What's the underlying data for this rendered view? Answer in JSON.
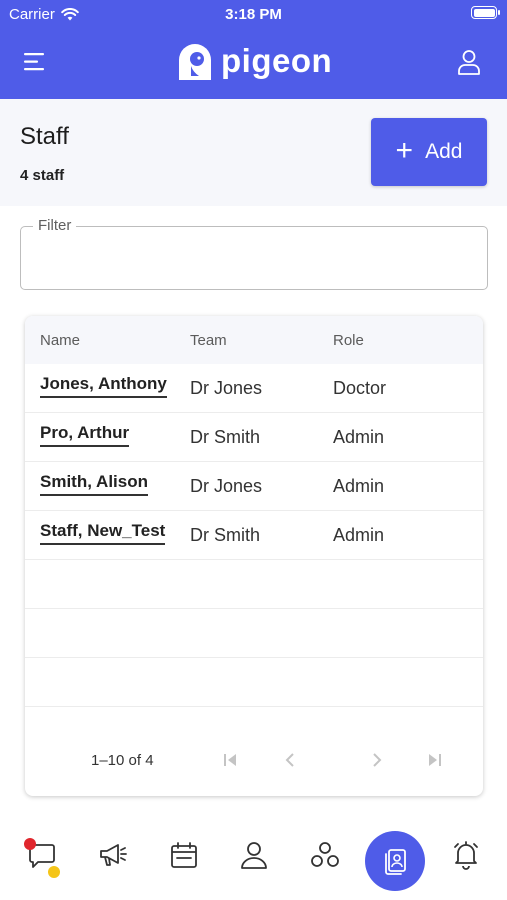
{
  "status_bar": {
    "carrier": "Carrier",
    "time": "3:18 PM"
  },
  "header": {
    "logo_text": "pigeon"
  },
  "page": {
    "title": "Staff",
    "count": "4 staff",
    "add_label": "Add"
  },
  "filter": {
    "label": "Filter",
    "value": "",
    "placeholder": ""
  },
  "table": {
    "columns": [
      "Name",
      "Team",
      "Role"
    ],
    "rows": [
      {
        "name": "Jones, Anthony",
        "team": "Dr Jones",
        "role": "Doctor"
      },
      {
        "name": "Pro, Arthur",
        "team": "Dr Smith",
        "role": "Admin"
      },
      {
        "name": "Smith, Alison",
        "team": "Dr Jones",
        "role": "Admin"
      },
      {
        "name": "Staff, New_Test",
        "team": "Dr Smith",
        "role": "Admin"
      }
    ],
    "pagination": "1–10 of 4"
  },
  "icons": {
    "menu": "menu-icon",
    "profile": "user-icon",
    "nav": [
      "chat-icon",
      "megaphone-icon",
      "calendar-icon",
      "person-icon",
      "network-icon",
      "contacts-icon",
      "bell-icon"
    ]
  },
  "colors": {
    "brand": "#4f5ce8",
    "badge_red": "#e0262d",
    "badge_yellow": "#f5c518"
  }
}
